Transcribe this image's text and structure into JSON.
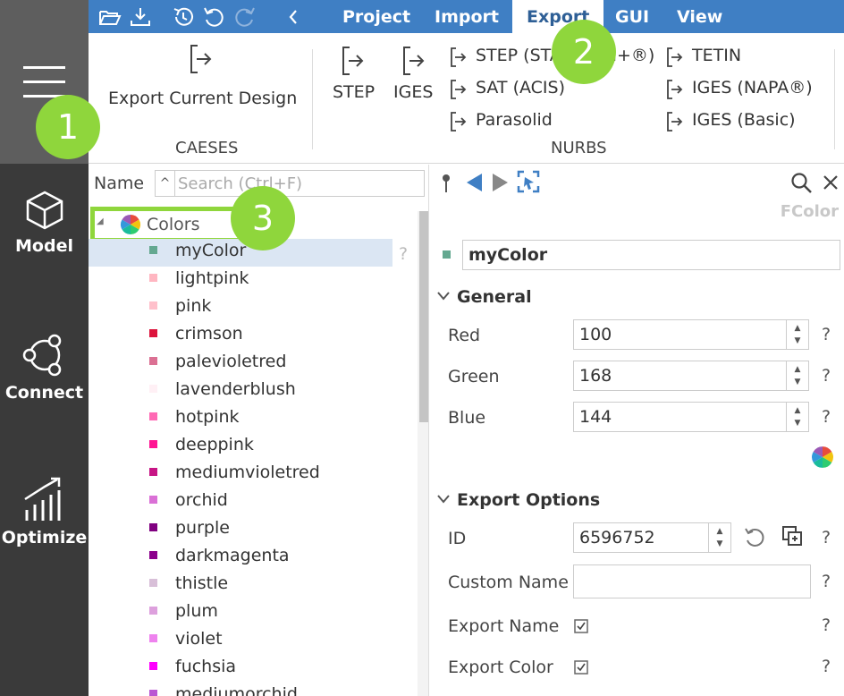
{
  "rail": {
    "items": [
      {
        "label": "Model",
        "icon": "cube-icon"
      },
      {
        "label": "Connect",
        "icon": "connect-icon"
      },
      {
        "label": "Optimize",
        "icon": "optimize-icon"
      }
    ]
  },
  "menu": {
    "tabs": [
      {
        "label": "Project",
        "active": false
      },
      {
        "label": "Import",
        "active": false
      },
      {
        "label": "Export",
        "active": true
      },
      {
        "label": "GUI",
        "active": false
      },
      {
        "label": "View",
        "active": false
      }
    ]
  },
  "ribbon": {
    "caeses": {
      "export_current_design": "Export Current Design",
      "group_label": "CAESES"
    },
    "nurbs": {
      "step": "STEP",
      "iges": "IGES",
      "step_star": "STEP (STAR-CCM+®)",
      "sat": "SAT (ACIS)",
      "parasolid": "Parasolid",
      "tetin": "TETIN",
      "iges_napa": "IGES (NAPA®)",
      "iges_basic": "IGES (Basic)",
      "group_label": "NURBS"
    }
  },
  "tree": {
    "column_header": "Name",
    "search_placeholder": "Search (Ctrl+F)",
    "root": "Colors",
    "selected_help": "?",
    "items": [
      {
        "name": "myColor",
        "color": "#64a890"
      },
      {
        "name": "lightpink",
        "color": "#ffb6c1"
      },
      {
        "name": "pink",
        "color": "#ffc0cb"
      },
      {
        "name": "crimson",
        "color": "#dc143c"
      },
      {
        "name": "palevioletred",
        "color": "#db7093"
      },
      {
        "name": "lavenderblush",
        "color": "#fff0f5"
      },
      {
        "name": "hotpink",
        "color": "#ff69b4"
      },
      {
        "name": "deeppink",
        "color": "#ff1493"
      },
      {
        "name": "mediumvioletred",
        "color": "#c71585"
      },
      {
        "name": "orchid",
        "color": "#da70d6"
      },
      {
        "name": "purple",
        "color": "#800080"
      },
      {
        "name": "darkmagenta",
        "color": "#8b008b"
      },
      {
        "name": "thistle",
        "color": "#d8bfd8"
      },
      {
        "name": "plum",
        "color": "#dda0dd"
      },
      {
        "name": "violet",
        "color": "#ee82ee"
      },
      {
        "name": "fuchsia",
        "color": "#ff00ff"
      },
      {
        "name": "mediumorchid",
        "color": "#ba55d3"
      }
    ]
  },
  "props": {
    "type_label": "FColor",
    "name_value": "myColor",
    "general": {
      "title": "General",
      "red_label": "Red",
      "red_value": "100",
      "green_label": "Green",
      "green_value": "168",
      "blue_label": "Blue",
      "blue_value": "144"
    },
    "export_options": {
      "title": "Export Options",
      "id_label": "ID",
      "id_value": "6596752",
      "custom_name_label": "Custom Name",
      "custom_name_value": "",
      "export_name_label": "Export Name",
      "export_name_checked": true,
      "export_color_label": "Export Color",
      "export_color_checked": true
    },
    "help": "?"
  },
  "callouts": [
    "1",
    "2",
    "3"
  ],
  "colors": {
    "accent_blue": "#3f7fc4",
    "callout_green": "#8fd63c",
    "rail_dark": "#3a3a3a",
    "rail_top": "#5e5e5e",
    "selection": "#dbe6f3"
  }
}
